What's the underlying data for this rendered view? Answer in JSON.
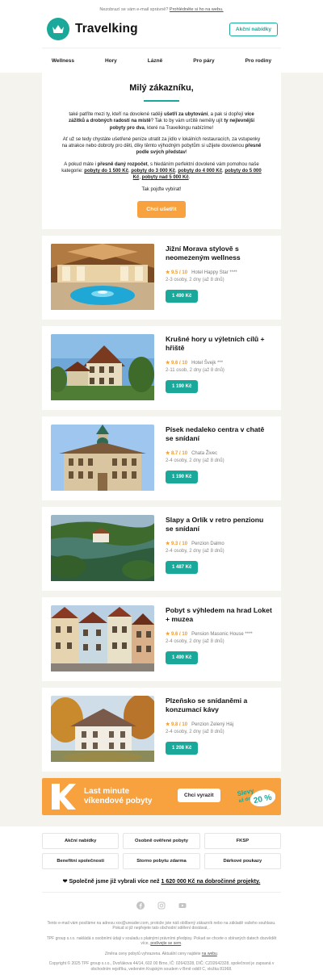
{
  "preheader": {
    "text": "Nezobrazí se vám e-mail správně?",
    "link": "Prohlédněte si ho na webu."
  },
  "brand": {
    "name": "Travelking",
    "deals_button": "Akční nabídky",
    "accent": "#1aa89a",
    "orange": "#f7a23e"
  },
  "nav": [
    "Wellness",
    "Hory",
    "Lázně",
    "Pro páry",
    "Pro rodiny"
  ],
  "intro": {
    "title": "Milý zákazníku,",
    "p1_a": "také patříte mezi ty, kteří na dovolené raději ",
    "p1_b": "ušetří za ubytování",
    "p1_c": ", a pak si dopřejí ",
    "p1_d": "více zážitků a drobných radostí na místě",
    "p1_e": "? Tak to by vám určitě neměly ujít ",
    "p1_f": "ty nejlevnější pobyty pro dva",
    "p1_g": ", které na Travelkingu nabízíme!",
    "p2_a": "Ať už se tedy chystáte ušetřené peníze utratit za jídlo v lokálních restauracích, za vstupenky na atrakce nebo dobroty pro děti, díky těmto výhodným pobytům si užijete dovolenou ",
    "p2_b": "přesně podle svých představ",
    "p2_c": "!",
    "p3_a": "A pokud máte i ",
    "p3_b": "přesně daný rozpočet",
    "p3_c": ", s hledáním perfektní dovolené vám pomohou naše kategorie: ",
    "cat1": "pobyty do 1 500 Kč",
    "cat2": "pobyty do 3 000 Kč",
    "cat3": "pobyty do 4 000 Kč",
    "cat4": "pobyty do 5 000 Kč",
    "cat5": "pobyty nad 5 000 Kč",
    "sep": ", ",
    "end": ".",
    "p4": "Tak pojďte vybírat!",
    "cta": "Chci ušetřit"
  },
  "hotels": [
    {
      "title": "Jižní Morava stylově s neomezeným wellness",
      "rating": "★ 9.5 / 10",
      "hotel": "Hotel Happy Star ****",
      "meta": "2-3 osoby, 2 dny (až 8 dnů)",
      "price": "1 490 Kč"
    },
    {
      "title": "Krušné hory u výletních cílů + hřiště",
      "rating": "★ 9.6 / 10",
      "hotel": "Hotel Švejk ***",
      "meta": "2-11 osob, 2 dny (až 8 dnů)",
      "price": "1 190 Kč"
    },
    {
      "title": "Písek nedaleko centra v chatě se snídaní",
      "rating": "★ 8.7 / 10",
      "hotel": "Chata Živec",
      "meta": "2-4 osoby, 2 dny (až 8 dnů)",
      "price": "1 190 Kč"
    },
    {
      "title": "Slapy a Orlík v retro penzionu se snídaní",
      "rating": "★ 9.3 / 10",
      "hotel": "Penzion Dalmo",
      "meta": "2-4 osoby, 2 dny (až 8 dnů)",
      "price": "1 487 Kč"
    },
    {
      "title": "Pobyt s výhledem na hrad Loket + muzea",
      "rating": "★ 9.6 / 10",
      "hotel": "Pension Masonic House ****",
      "meta": "2-4 osoby, 2 dny (až 8 dnů)",
      "price": "1 490 Kč"
    },
    {
      "title": "Plzeňsko se snídaněmi a konzumací kávy",
      "rating": "★ 9.8 / 10",
      "hotel": "Penzion Zelený Háj",
      "meta": "2-4 osoby, 2 dny (až 8 dnů)",
      "price": "1 208 Kč"
    }
  ],
  "banner": {
    "line1": "Last minute",
    "line2": "víkendové pobyty",
    "button": "Chci vyrazit",
    "badge_top": "Slevy",
    "badge_mid": "až do",
    "badge_big": "20 %"
  },
  "footer": {
    "links": [
      "Akční nabídky",
      "Osobně ověřené pobyty",
      "FKSP",
      "Benefitní společnosti",
      "Storno pobytu zdarma",
      "Dárkové poukazy"
    ],
    "charity_a": "Společně jsme již vybrali více než ",
    "charity_b": "1 620 000 Kč na dobročinné projekty.",
    "legal1": "Tento e-mail vám posíláme na adresu xxx@ureader.com, protože jste náš oblíbený zákazník nebo na základě vašeho souhlasu. Pokud si již nepřejete tato obchodní sdělení dostávat, .",
    "legal2a": "TPF group s.r.o. nakládá s osobními údaji v souladu s platnými právními předpisy. Pokud se chcete o sbíraných datech dozvědět více, ",
    "legal2b": "podívejte se sem",
    "legal2c": ".",
    "legal3a": "Změna ceny pobytů vyhrazena. Aktuální ceny najdete ",
    "legal3b": "na webu",
    "legal3c": ".",
    "legal4": "Copyright © 2025 TPF group s.r.o., Dvořákova 44/14, 602 00 Brno, IČ: 02642328, DIČ: CZ02642328, společnost je zapsaná v obchodním rejstříku, vedeném Krajským soudem v Brně oddíl C, vložka 81968."
  }
}
